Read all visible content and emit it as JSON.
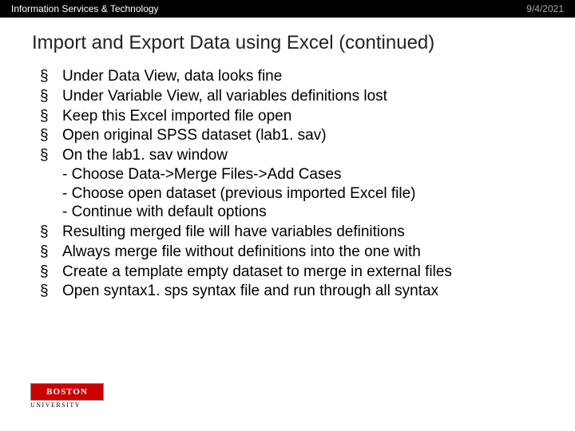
{
  "header": {
    "left": "Information Services & Technology",
    "right": "9/4/2021"
  },
  "title": "Import and Export Data using Excel (continued)",
  "bullets": [
    {
      "text": "Under Data View, data looks fine"
    },
    {
      "text": "Under Variable View, all variables definitions lost"
    },
    {
      "text": "Keep this Excel imported file open"
    },
    {
      "text": "Open original SPSS dataset (lab1. sav)"
    },
    {
      "text": "On the lab1. sav window",
      "subs": [
        "- Choose Data->Merge Files->Add Cases",
        "- Choose open dataset (previous imported Excel file)",
        "- Continue with default options"
      ]
    },
    {
      "text": "Resulting merged file will have variables definitions"
    },
    {
      "text": "Always merge file without definitions into the one with"
    },
    {
      "text": "Create a template empty dataset to merge in external files"
    },
    {
      "text": "Open syntax1. sps syntax file and run through all syntax"
    }
  ],
  "logo": {
    "top": "BOSTON",
    "bottom": "UNIVERSITY"
  }
}
